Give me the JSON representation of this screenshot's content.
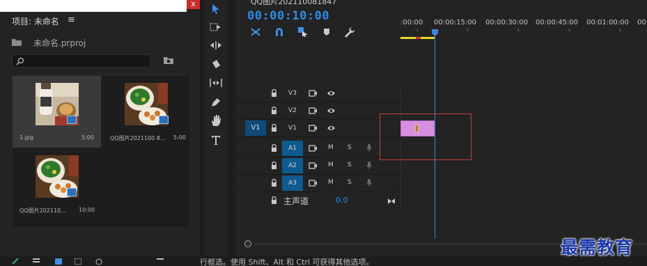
{
  "project": {
    "title": "项目: 未命名",
    "menu_glyph": "≡",
    "close_glyph": "x",
    "project_file": "未命名.prproj",
    "search_placeholder": "",
    "items": [
      {
        "name": "1.jpg",
        "duration": "5:00",
        "selected": true
      },
      {
        "name": "QQ图片2021100 8...",
        "duration": "5:00",
        "selected": false
      },
      {
        "name": "QQ图片202110...",
        "duration": "10:00",
        "selected": false
      }
    ]
  },
  "status_bar": {
    "text": "行框选。使用 Shift、Alt 和 Ctrl 可获得其他选项。"
  },
  "tools": [
    "selection-tool",
    "track-select-forward-tool",
    "ripple-edit-tool",
    "razor-tool",
    "slip-tool",
    "pen-tool",
    "hand-tool",
    "type-tool"
  ],
  "timeline": {
    "tab_label": "QQ图片202110081847",
    "timecode": "00:00:10:00",
    "toolbar_icons": [
      "snap-icon",
      "linked-selection-icon",
      "add-marker-icon",
      "marker-icon",
      "wrench-icon"
    ],
    "ruler_labels": [
      ":00:00",
      "00:00:15:00",
      "00:00:30:00",
      "00:00:45:00",
      "00:01:00:00",
      "00:"
    ],
    "video_tracks": [
      {
        "label": "V3",
        "source": ""
      },
      {
        "label": "V2",
        "source": ""
      },
      {
        "label": "V1",
        "source": "V1"
      }
    ],
    "audio_tracks": [
      {
        "label": "A1",
        "mute": "M",
        "solo": "S"
      },
      {
        "label": "A2",
        "mute": "M",
        "solo": "S"
      },
      {
        "label": "A3",
        "mute": "M",
        "solo": "S"
      }
    ],
    "master": {
      "label": "主声道",
      "value": "0.0"
    },
    "clip": {
      "track": "V1",
      "color": "#d98fe0"
    }
  },
  "watermark": "最需教育",
  "colors": {
    "accent": "#2e8ae6",
    "playhead": "#3b86d8",
    "clip": "#d98fe0",
    "annotation_box": "#c9403a",
    "work_area": "#e8d62c"
  }
}
